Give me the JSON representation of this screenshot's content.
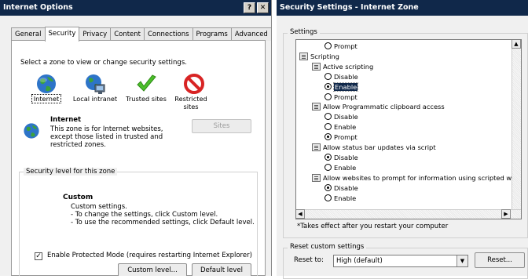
{
  "internet_options": {
    "title": "Internet Options",
    "help_label": "?",
    "close_label": "✕",
    "tabs": [
      "General",
      "Security",
      "Privacy",
      "Content",
      "Connections",
      "Programs",
      "Advanced"
    ],
    "active_tab": "Security",
    "zone_prompt": "Select a zone to view or change security settings.",
    "zones": [
      {
        "label": "Internet",
        "icon": "globe-icon"
      },
      {
        "label": "Local intranet",
        "icon": "intranet-icon"
      },
      {
        "label": "Trusted sites",
        "icon": "checkmark-icon"
      },
      {
        "label": "Restricted sites",
        "icon": "restricted-icon"
      }
    ],
    "zone_title": "Internet",
    "zone_description": "This zone is for Internet websites, except those listed in trusted and restricted zones.",
    "sites_button": "Sites",
    "security_level_group": "Security level for this zone",
    "level_title": "Custom",
    "level_lines": [
      "Custom settings.",
      "- To change the settings, click Custom level.",
      "- To use the recommended settings, click Default level."
    ],
    "protected_mode_label": "Enable Protected Mode (requires restarting Internet Explorer)",
    "protected_mode_checked": true,
    "custom_level_button": "Custom level...",
    "default_level_button": "Default level"
  },
  "security_settings": {
    "title": "Security Settings - Internet Zone",
    "settings_group": "Settings",
    "tree": [
      {
        "kind": "radio",
        "label": "Prompt",
        "checked": false
      },
      {
        "kind": "category",
        "label": "Scripting"
      },
      {
        "kind": "setting",
        "label": "Active scripting"
      },
      {
        "kind": "radio",
        "label": "Disable",
        "checked": false
      },
      {
        "kind": "radio",
        "label": "Enable",
        "checked": true,
        "selected": true
      },
      {
        "kind": "radio",
        "label": "Prompt",
        "checked": false
      },
      {
        "kind": "setting",
        "label": "Allow Programmatic clipboard access"
      },
      {
        "kind": "radio",
        "label": "Disable",
        "checked": false
      },
      {
        "kind": "radio",
        "label": "Enable",
        "checked": false
      },
      {
        "kind": "radio",
        "label": "Prompt",
        "checked": true
      },
      {
        "kind": "setting",
        "label": "Allow status bar updates via script"
      },
      {
        "kind": "radio",
        "label": "Disable",
        "checked": true
      },
      {
        "kind": "radio",
        "label": "Enable",
        "checked": false
      },
      {
        "kind": "setting",
        "label": "Allow websites to prompt for information using scripted windo"
      },
      {
        "kind": "radio",
        "label": "Disable",
        "checked": true
      },
      {
        "kind": "radio",
        "label": "Enable",
        "checked": false
      }
    ],
    "restart_note": "*Takes effect after you restart your computer",
    "reset_group": "Reset custom settings",
    "reset_to_label": "Reset to:",
    "reset_value": "High (default)",
    "reset_button": "Reset..."
  }
}
